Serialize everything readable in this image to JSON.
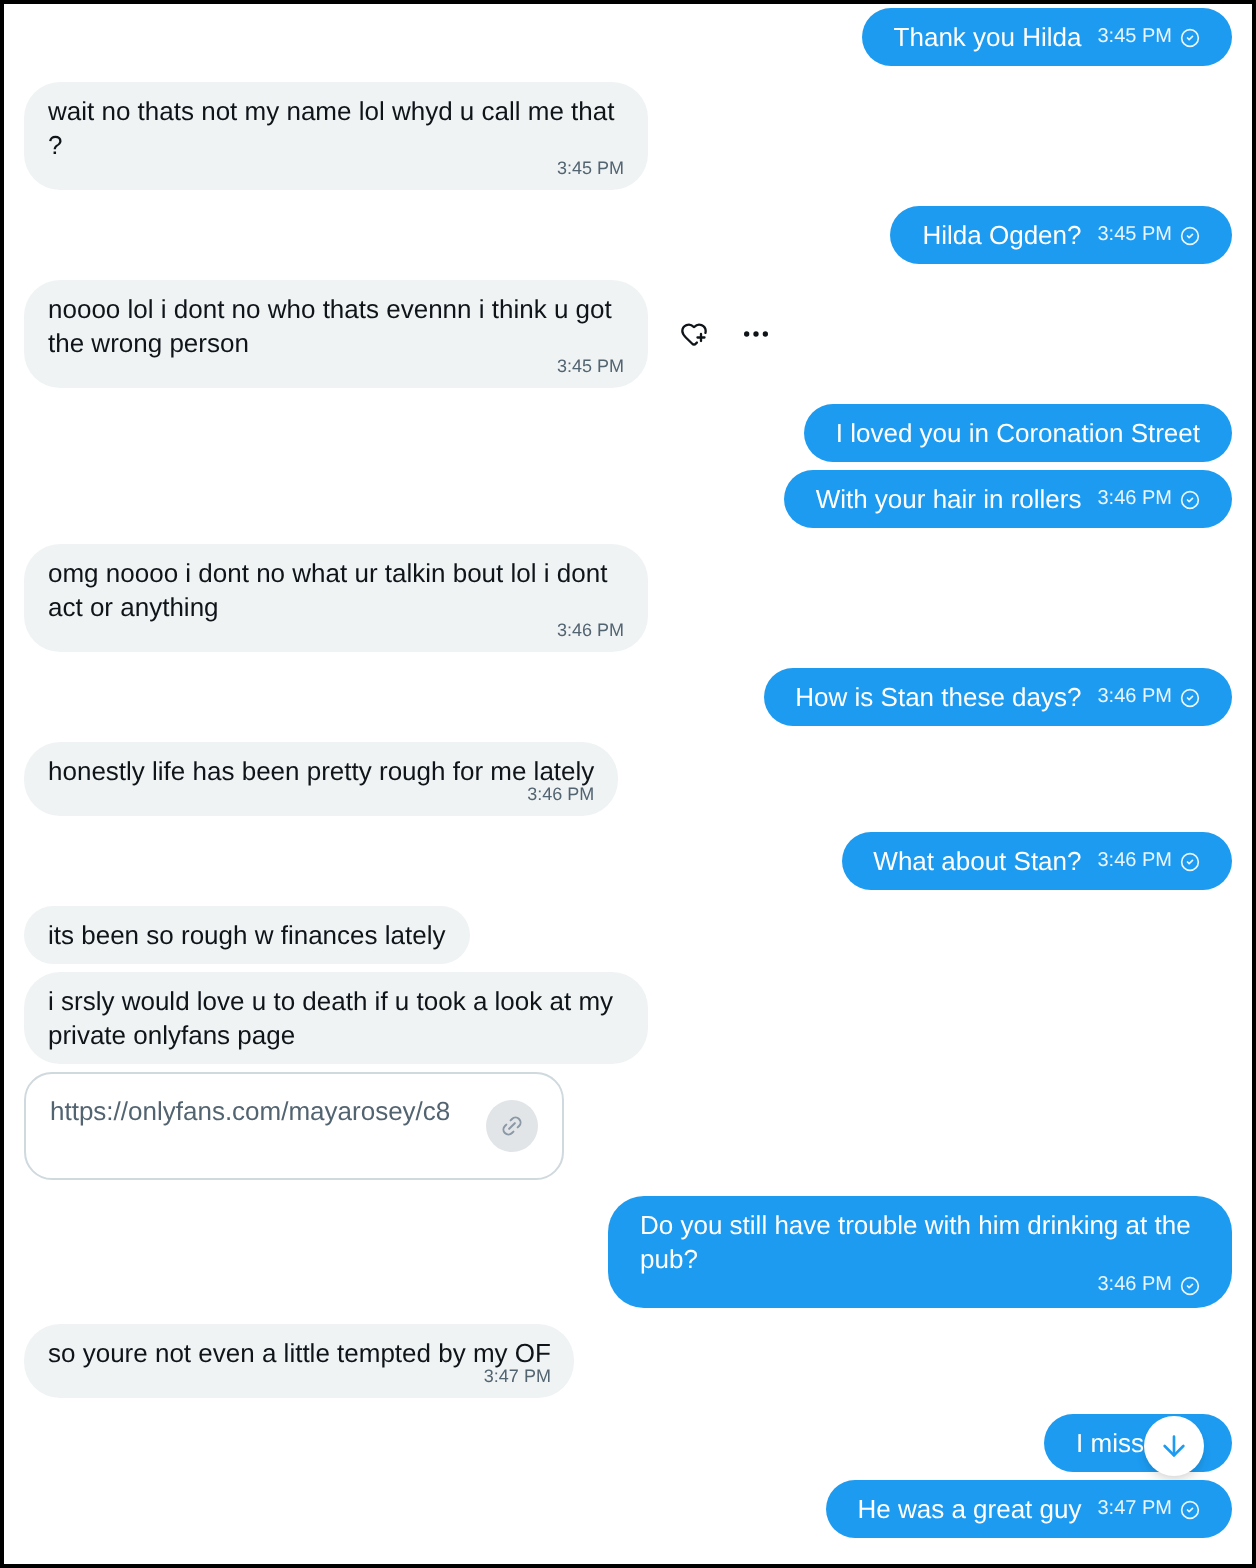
{
  "messages": [
    {
      "kind": "sent",
      "text": "Thank you Hilda",
      "time": "3:45 PM"
    },
    {
      "kind": "received",
      "text": "wait no thats not my name lol whyd u call me that ?",
      "time": "3:45 PM"
    },
    {
      "kind": "sent",
      "text": "Hilda Ogden?",
      "time": "3:45 PM"
    },
    {
      "kind": "received",
      "text": "noooo lol i dont no who thats evennn i think u got the wrong person",
      "time": "3:45 PM",
      "hovered": true
    },
    {
      "kind": "sent",
      "text": "I loved you in Coronation Street"
    },
    {
      "kind": "sent",
      "text": "With your hair in rollers",
      "time": "3:46 PM"
    },
    {
      "kind": "received",
      "text": "omg noooo i dont no what ur talkin bout lol i dont act or anything",
      "time": "3:46 PM"
    },
    {
      "kind": "sent",
      "text": "How is Stan these days?",
      "time": "3:46 PM"
    },
    {
      "kind": "received",
      "text": "honestly life has been pretty rough for me lately",
      "time": "3:46 PM"
    },
    {
      "kind": "sent",
      "text": "What about Stan?",
      "time": "3:46 PM"
    },
    {
      "kind": "received",
      "text": "its been so rough w finances lately"
    },
    {
      "kind": "received",
      "text": "i srsly would love u to death if u took a look at my private onlyfans page"
    },
    {
      "kind": "link",
      "text": "https://onlyfans.com/mayarosey/c8"
    },
    {
      "kind": "sent",
      "text": "Do you still have trouble with him drinking at the pub?",
      "time": "3:46 PM"
    },
    {
      "kind": "received",
      "text": "so youre not even a little tempted by my OF",
      "time": "3:47 PM"
    },
    {
      "kind": "sent",
      "text": "I miss",
      "covered": true
    },
    {
      "kind": "sent",
      "text": "He was a great guy",
      "time": "3:47 PM"
    }
  ]
}
